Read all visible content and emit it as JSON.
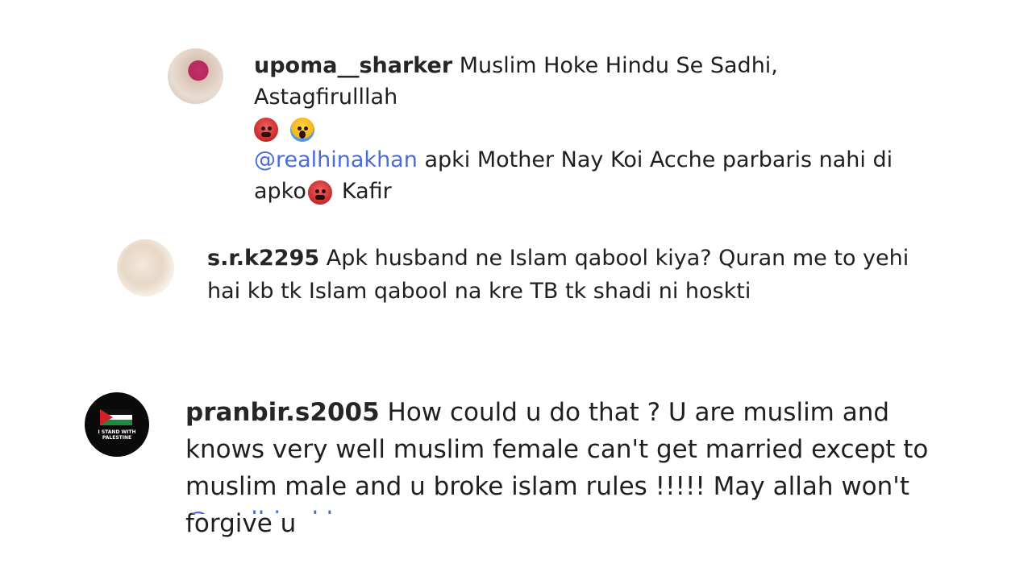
{
  "comments": [
    {
      "username": "upoma__sharker",
      "text_line1": "Muslim Hoke Hindu Se Sadhi, Astagfirulllah",
      "mention": "@realhinakhan",
      "text_line2": "apki Mother Nay Koi Acche parbaris nahi di",
      "text_line3_prefix": "apko",
      "text_line3_suffix": "Kafir",
      "emojis": [
        "angry-face-icon",
        "screaming-face-icon"
      ]
    },
    {
      "username": "s.r.k2295",
      "text": "Apk husband ne Islam qabool kiya? Quran me to yehi hai kb tk Islam qabool na kre TB tk shadi ni hoskti"
    },
    {
      "username": "pranbir.s2005",
      "text": "How could u do that ? U are muslim and knows very well muslim female can't get married except to muslim male and u broke islam rules !!!!! May allah won't forgive u",
      "avatar_text": "I STAND WITH PALESTINE",
      "partial_mention": "@realhinakh"
    }
  ],
  "colors": {
    "mention": "#4a6bd8",
    "username": "#262626",
    "text": "#1f1f1f",
    "background": "#ffffff"
  }
}
